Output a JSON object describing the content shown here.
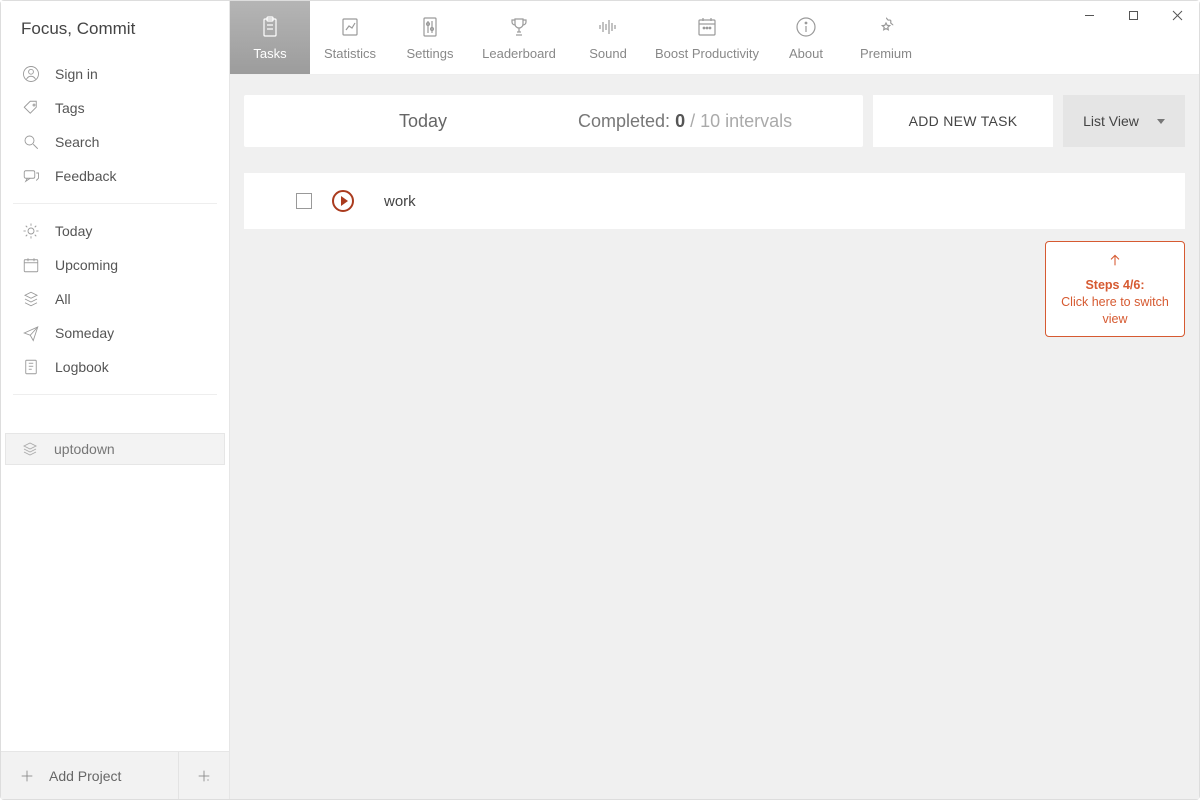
{
  "app_title": "Focus, Commit",
  "sidebar": {
    "top_items": [
      {
        "label": "Sign in"
      },
      {
        "label": "Tags"
      },
      {
        "label": "Search"
      },
      {
        "label": "Feedback"
      }
    ],
    "nav_items": [
      {
        "label": "Today"
      },
      {
        "label": "Upcoming"
      },
      {
        "label": "All"
      },
      {
        "label": "Someday"
      },
      {
        "label": "Logbook"
      }
    ],
    "project": {
      "name": "uptodown"
    },
    "add_project_label": "Add Project"
  },
  "topbar": {
    "tabs": [
      {
        "label": "Tasks"
      },
      {
        "label": "Statistics"
      },
      {
        "label": "Settings"
      },
      {
        "label": "Leaderboard"
      },
      {
        "label": "Sound"
      },
      {
        "label": "Boost Productivity"
      },
      {
        "label": "About"
      },
      {
        "label": "Premium"
      }
    ]
  },
  "summary": {
    "today_label": "Today",
    "completed_prefix": "Completed: ",
    "completed_value": "0",
    "completed_suffix": " / 10 intervals"
  },
  "actions": {
    "add_task": "ADD NEW TASK",
    "view_mode": "List View"
  },
  "tasks": [
    {
      "title": "work"
    }
  ],
  "tooltip": {
    "step": "Steps 4/6:",
    "text": "Click here to switch view"
  }
}
